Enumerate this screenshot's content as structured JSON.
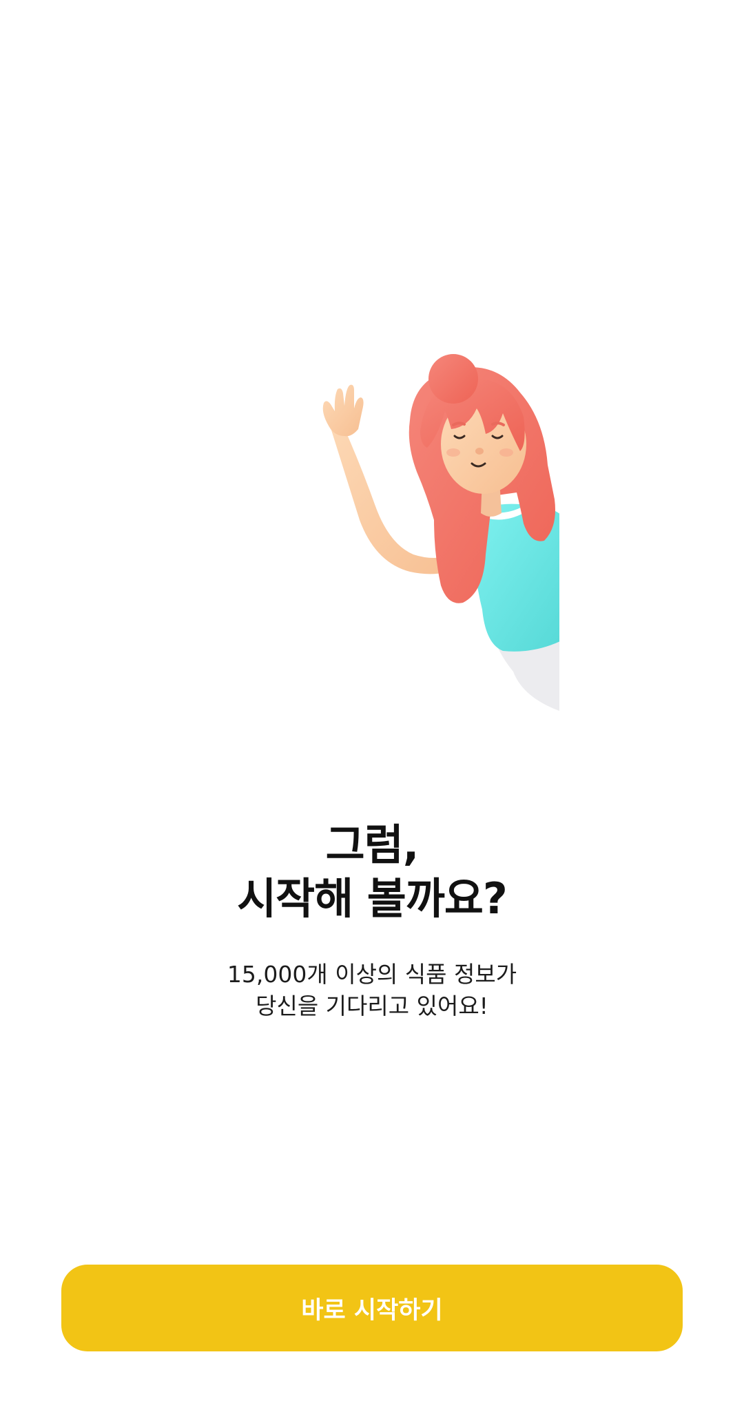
{
  "illustration": {
    "icon": "waving-girl-illustration",
    "colors": {
      "hair": "#F27264",
      "skin": "#FCCEA5",
      "shirt": "#6EEAE8",
      "pants": "#EDEDF0"
    }
  },
  "headline": {
    "line1": "그럼,",
    "line2": "시작해 볼까요?"
  },
  "subtext": {
    "line1": "15,000개 이상의 식품 정보가",
    "line2": "당신을 기다리고 있어요!"
  },
  "start_button": {
    "label": "바로 시작하기",
    "color": "#F2C415"
  }
}
